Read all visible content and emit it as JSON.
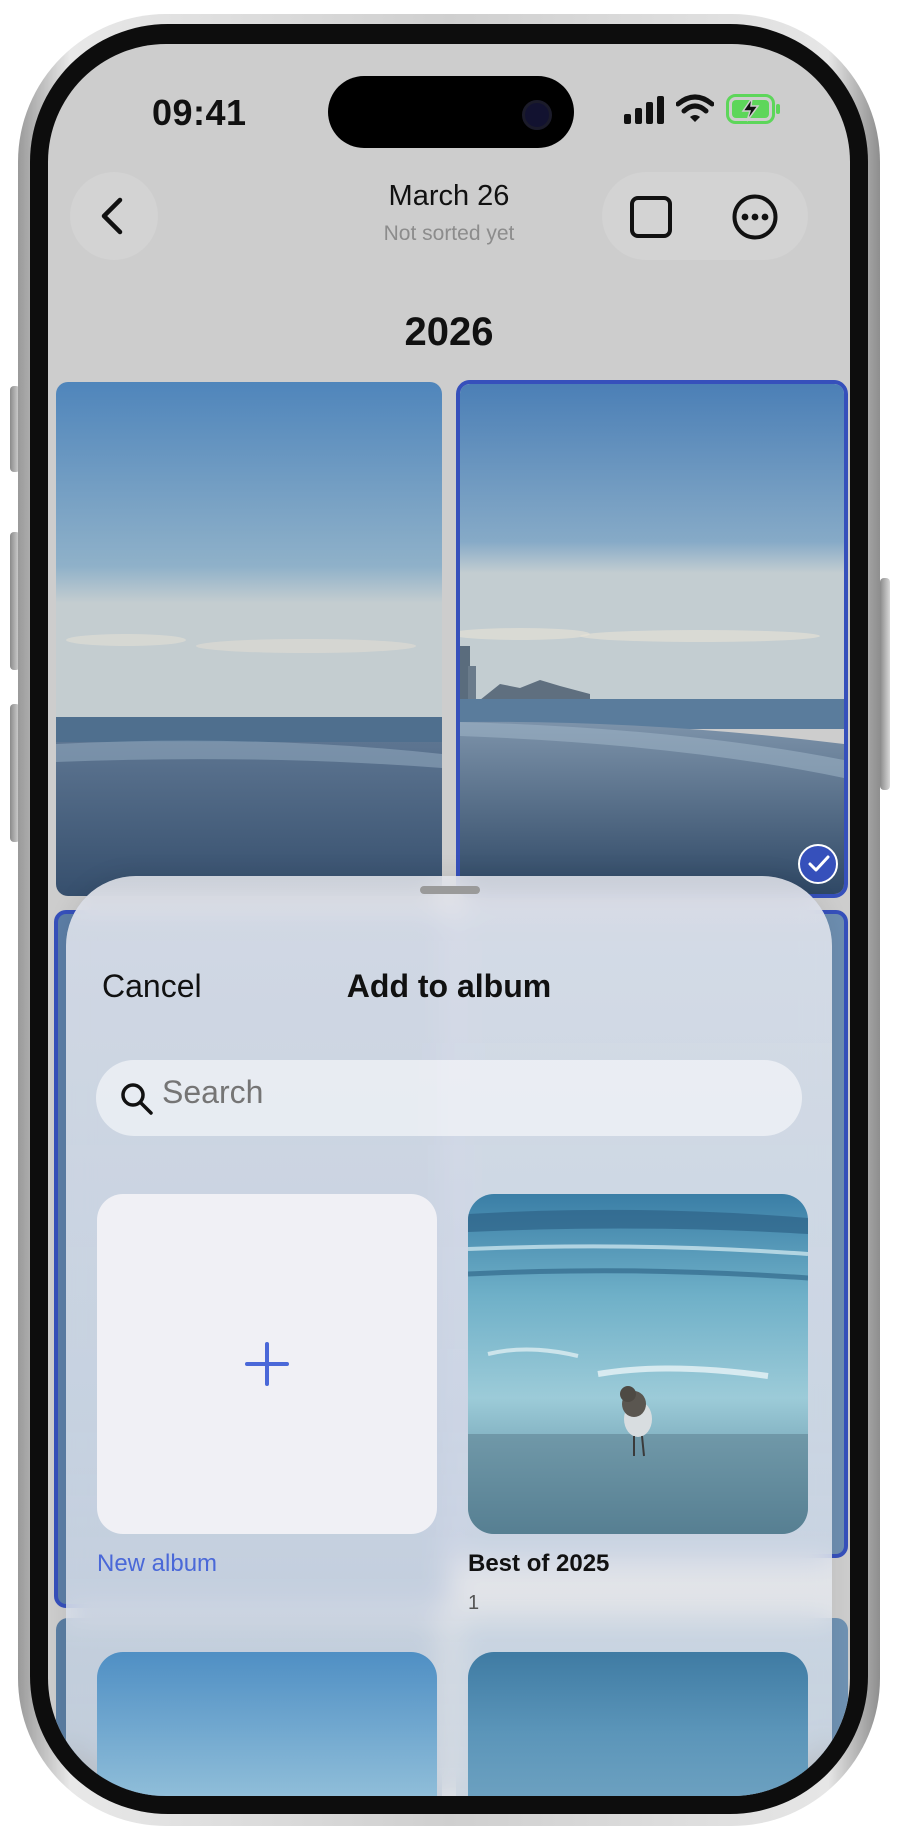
{
  "status_bar": {
    "time": "09:41",
    "icons": [
      "cellular-signal-icon",
      "wifi-icon",
      "battery-charging-icon"
    ]
  },
  "header": {
    "back_icon": "chevron-left-icon",
    "title": "March 26",
    "subtitle": "Not sorted yet",
    "select_icon": "square-icon",
    "more_icon": "ellipsis-circle-icon"
  },
  "section": {
    "year": "2026"
  },
  "photos": [
    {
      "selected": false
    },
    {
      "selected": true
    }
  ],
  "sheet": {
    "cancel_label": "Cancel",
    "title": "Add to album",
    "search": {
      "placeholder": "Search"
    },
    "albums": [
      {
        "name": "New album",
        "count": "",
        "icon": "plus-icon"
      },
      {
        "name": "Best of 2025",
        "count": "1"
      }
    ]
  },
  "colors": {
    "accent": "#3650BB",
    "accent_light": "#4A68D8",
    "screen_background": "#CDCDCD",
    "battery": "#5DD65A"
  }
}
